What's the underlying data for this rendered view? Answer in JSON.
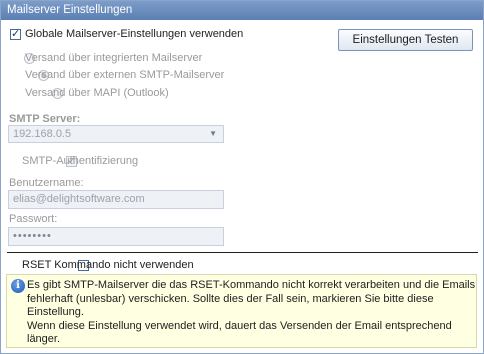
{
  "window": {
    "title": "Mailserver Einstellungen"
  },
  "global_settings": {
    "label": "Globale Mailserver-Einstellungen verwenden",
    "checked": true
  },
  "test_button": {
    "label": "Einstellungen Testen"
  },
  "send_options": [
    {
      "label": "Versand über integrierten Mailserver",
      "selected": false
    },
    {
      "label": "Versand über externen SMTP-Mailserver",
      "selected": true
    },
    {
      "label": "Versand über MAPI (Outlook)",
      "selected": false
    }
  ],
  "smtp_server": {
    "label": "SMTP Server:",
    "value": "192.168.0.5"
  },
  "smtp_auth": {
    "label": "SMTP-Authentifizierung",
    "checked": true
  },
  "username": {
    "label": "Benutzername:",
    "value": "elias@delightsoftware.com"
  },
  "password": {
    "label": "Passwort:",
    "value": "••••••••"
  },
  "rset": {
    "label": "RSET Kommando nicht verwenden",
    "checked": false
  },
  "info": {
    "icon": "info-icon",
    "line1": "Es gibt SMTP-Mailserver die das RSET-Kommando nicht korrekt verarbeiten und die Emails",
    "line2": "fehlerhaft (unlesbar) verschicken. Sollte dies der Fall sein, markieren Sie bitte diese",
    "line3": "Einstellung.",
    "line4": "Wenn diese Einstellung verwendet wird, dauert das Versenden der Email entsprechend",
    "line5": "länger."
  },
  "colors": {
    "titlebar": "#6689bd",
    "info_background": "#ffffe1",
    "accent": "#1d56b8"
  }
}
